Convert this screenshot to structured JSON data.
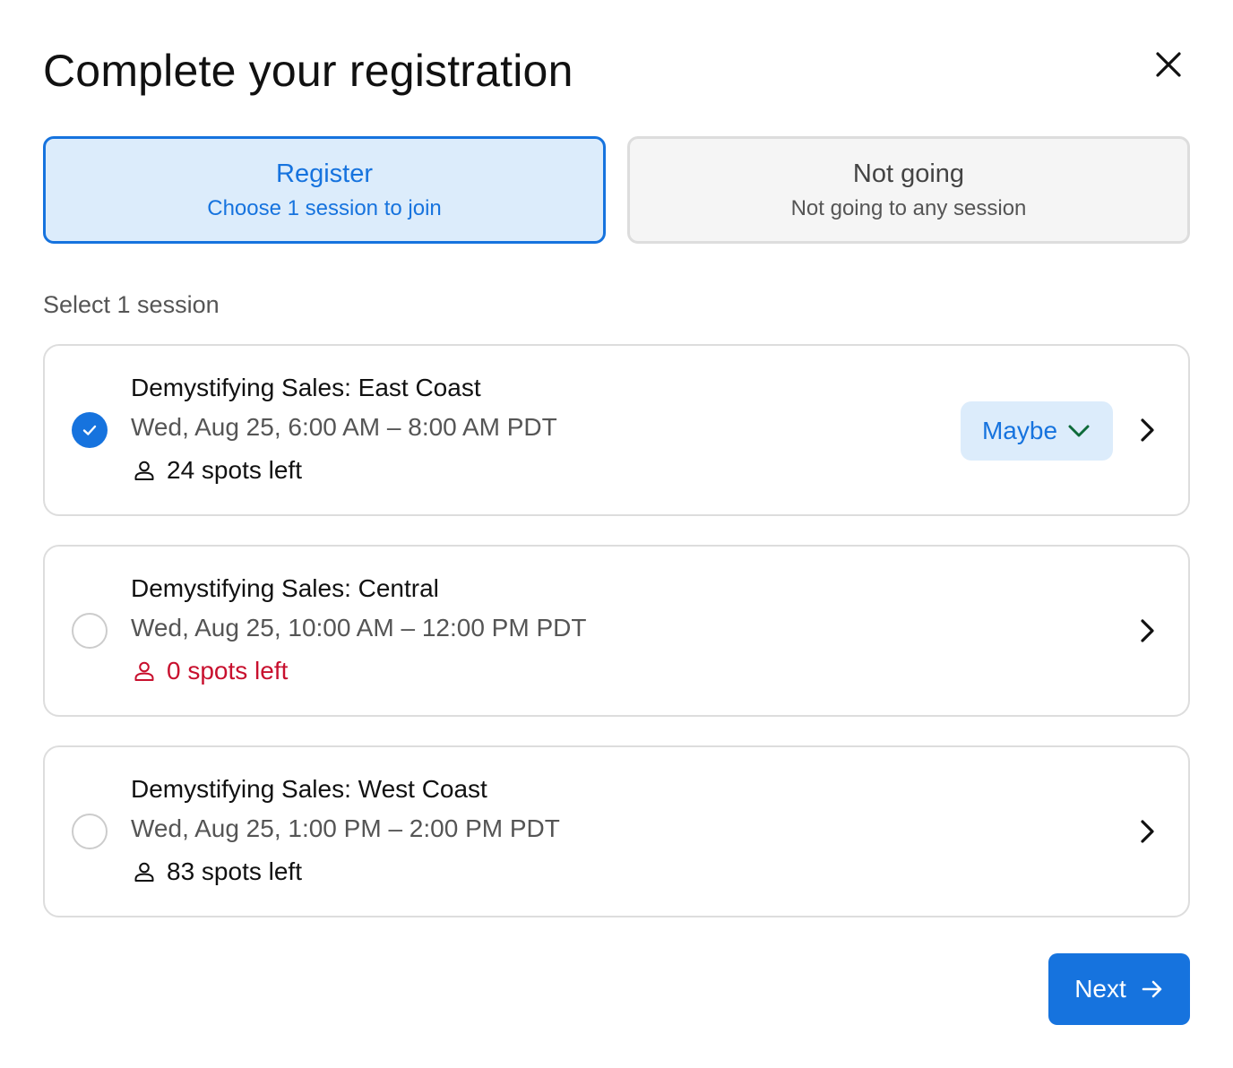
{
  "dialog": {
    "title": "Complete your registration"
  },
  "options": {
    "register": {
      "title": "Register",
      "subtitle": "Choose 1 session to join",
      "selected": true
    },
    "not_going": {
      "title": "Not going",
      "subtitle": "Not going to any session",
      "selected": false
    }
  },
  "sessions": {
    "label": "Select 1 session",
    "items": [
      {
        "name": "Demystifying Sales: East Coast",
        "time": "Wed, Aug 25, 6:00 AM – 8:00 AM PDT",
        "spots": "24 spots left",
        "selected": true,
        "rsvp": "Maybe"
      },
      {
        "name": "Demystifying Sales: Central",
        "time": "Wed, Aug 25, 10:00 AM – 12:00 PM PDT",
        "spots": "0 spots left",
        "selected": false
      },
      {
        "name": "Demystifying Sales: West Coast",
        "time": "Wed, Aug 25, 1:00 PM – 2:00 PM PDT",
        "spots": "83 spots left",
        "selected": false
      }
    ]
  },
  "footer": {
    "next_label": "Next"
  },
  "colors": {
    "accent": "#1673de",
    "accent_bg": "#dcecfb",
    "danger": "#c8102e",
    "maybe_chevron": "#0e6b3a"
  },
  "icons": {
    "close": "close-icon",
    "check": "check-icon",
    "person": "person-icon",
    "chevron_down": "chevron-down-icon",
    "chevron_right": "chevron-right-icon",
    "arrow_right": "arrow-right-icon"
  }
}
